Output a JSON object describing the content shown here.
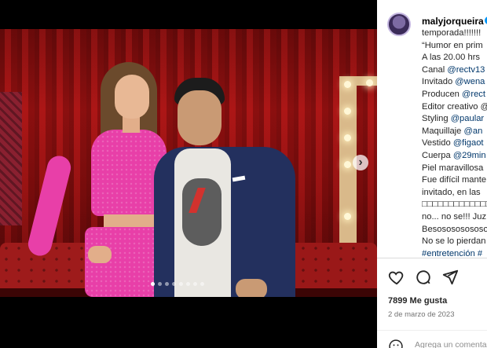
{
  "post": {
    "username": "malyjorqueira",
    "caption_lines": [
      {
        "text": "temporada!!!!!!!",
        "link": false
      },
      {
        "text": "“Humor en prim",
        "link": false
      },
      {
        "text": "A las 20.00 hrs",
        "link": false
      },
      {
        "prefix": "Canal ",
        "text": "@rectv13",
        "link": true
      },
      {
        "prefix": "Invitado ",
        "text": "@wena",
        "link": true
      },
      {
        "prefix": "Producen ",
        "text": "@rect",
        "link": true
      },
      {
        "text": "Editor creativo @",
        "link": false
      },
      {
        "prefix": "Styling ",
        "text": "@paular",
        "link": true
      },
      {
        "prefix": "Maquillaje ",
        "text": "@an",
        "link": true
      },
      {
        "prefix": "Vestido ",
        "text": "@figaot",
        "link": true
      },
      {
        "prefix": "Cuerpa ",
        "text": "@29min",
        "link": true
      },
      {
        "text": "Piel maravillosa",
        "link": false
      },
      {
        "text": "Fue difícil mante",
        "link": false
      },
      {
        "text": "invitado, en las",
        "link": false
      },
      {
        "text": "□□□□□□□□□□□□□",
        "link": false
      },
      {
        "text": "no... no se!!! Juz",
        "link": false
      },
      {
        "text": "Besosososososo",
        "link": false
      },
      {
        "text": "No se lo pierdan",
        "link": false
      },
      {
        "text": "#entretención #",
        "link": true
      }
    ],
    "likes": "7899 Me gusta",
    "date": "2 de marzo de 2023",
    "comment_placeholder": "Agrega un comentario..."
  },
  "carousel": {
    "slide_count": 8,
    "active_index": 0,
    "next_label": "›"
  },
  "icons": {
    "like": "heart-icon",
    "comment": "comment-icon",
    "share": "send-icon",
    "emoji": "emoji-icon",
    "verified": "verified-badge-icon"
  },
  "colors": {
    "accent": "#0095f6",
    "link": "#00376b"
  }
}
